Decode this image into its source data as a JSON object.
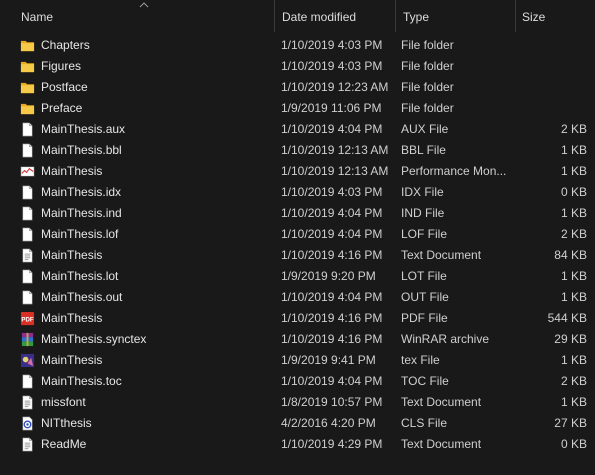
{
  "columns": {
    "name": "Name",
    "date": "Date modified",
    "type": "Type",
    "size": "Size"
  },
  "files": [
    {
      "name": "Chapters",
      "date": "1/10/2019 4:03 PM",
      "type": "File folder",
      "size": "",
      "icon": "folder-icon"
    },
    {
      "name": "Figures",
      "date": "1/10/2019 4:03 PM",
      "type": "File folder",
      "size": "",
      "icon": "folder-icon"
    },
    {
      "name": "Postface",
      "date": "1/10/2019 12:23 AM",
      "type": "File folder",
      "size": "",
      "icon": "folder-icon"
    },
    {
      "name": "Preface",
      "date": "1/9/2019 11:06 PM",
      "type": "File folder",
      "size": "",
      "icon": "folder-icon"
    },
    {
      "name": "MainThesis.aux",
      "date": "1/10/2019 4:04 PM",
      "type": "AUX File",
      "size": "2 KB",
      "icon": "file-icon"
    },
    {
      "name": "MainThesis.bbl",
      "date": "1/10/2019 12:13 AM",
      "type": "BBL File",
      "size": "1 KB",
      "icon": "file-icon"
    },
    {
      "name": "MainThesis",
      "date": "1/10/2019 12:13 AM",
      "type": "Performance Mon...",
      "size": "1 KB",
      "icon": "perfmon-icon"
    },
    {
      "name": "MainThesis.idx",
      "date": "1/10/2019 4:03 PM",
      "type": "IDX File",
      "size": "0 KB",
      "icon": "file-icon"
    },
    {
      "name": "MainThesis.ind",
      "date": "1/10/2019 4:04 PM",
      "type": "IND File",
      "size": "1 KB",
      "icon": "file-icon"
    },
    {
      "name": "MainThesis.lof",
      "date": "1/10/2019 4:04 PM",
      "type": "LOF File",
      "size": "2 KB",
      "icon": "file-icon"
    },
    {
      "name": "MainThesis",
      "date": "1/10/2019 4:16 PM",
      "type": "Text Document",
      "size": "84 KB",
      "icon": "text-document-icon"
    },
    {
      "name": "MainThesis.lot",
      "date": "1/9/2019 9:20 PM",
      "type": "LOT File",
      "size": "1 KB",
      "icon": "file-icon"
    },
    {
      "name": "MainThesis.out",
      "date": "1/10/2019 4:04 PM",
      "type": "OUT File",
      "size": "1 KB",
      "icon": "file-icon"
    },
    {
      "name": "MainThesis",
      "date": "1/10/2019 4:16 PM",
      "type": "PDF File",
      "size": "544 KB",
      "icon": "pdf-icon"
    },
    {
      "name": "MainThesis.synctex",
      "date": "1/10/2019 4:16 PM",
      "type": "WinRAR archive",
      "size": "29 KB",
      "icon": "winrar-icon"
    },
    {
      "name": "MainThesis",
      "date": "1/9/2019 9:41 PM",
      "type": "tex File",
      "size": "1 KB",
      "icon": "tex-icon"
    },
    {
      "name": "MainThesis.toc",
      "date": "1/10/2019 4:04 PM",
      "type": "TOC File",
      "size": "2 KB",
      "icon": "file-icon"
    },
    {
      "name": "missfont",
      "date": "1/8/2019 10:57 PM",
      "type": "Text Document",
      "size": "1 KB",
      "icon": "text-document-icon"
    },
    {
      "name": "NITthesis",
      "date": "4/2/2016 4:20 PM",
      "type": "CLS File",
      "size": "27 KB",
      "icon": "cls-icon"
    },
    {
      "name": "ReadMe",
      "date": "1/10/2019 4:29 PM",
      "type": "Text Document",
      "size": "0 KB",
      "icon": "text-document-icon"
    }
  ],
  "icon_text": {
    "pdf": "PDF"
  },
  "colors": {
    "background": "#191919",
    "folder": "#f5c33b",
    "text": "#e6e6e6",
    "divider": "#3a3a3a"
  }
}
